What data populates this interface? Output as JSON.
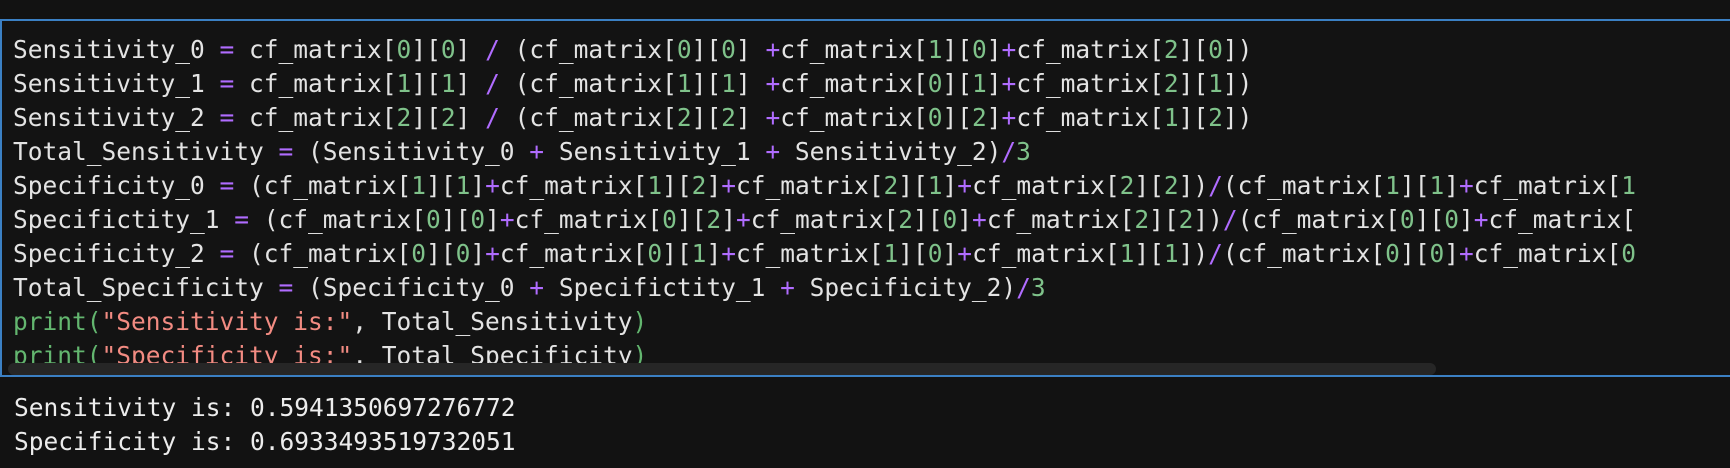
{
  "editor": {
    "lines": [
      [
        [
          "id",
          "Sensitivity_0 "
        ],
        [
          "op",
          "="
        ],
        [
          "id",
          " cf_matrix["
        ],
        [
          "num",
          "0"
        ],
        [
          "id",
          "]["
        ],
        [
          "num",
          "0"
        ],
        [
          "id",
          "] "
        ],
        [
          "op",
          "/"
        ],
        [
          "id",
          " (cf_matrix["
        ],
        [
          "num",
          "0"
        ],
        [
          "id",
          "]["
        ],
        [
          "num",
          "0"
        ],
        [
          "id",
          "] "
        ],
        [
          "op",
          "+"
        ],
        [
          "id",
          "cf_matrix["
        ],
        [
          "num",
          "1"
        ],
        [
          "id",
          "]["
        ],
        [
          "num",
          "0"
        ],
        [
          "id",
          "]"
        ],
        [
          "op",
          "+"
        ],
        [
          "id",
          "cf_matrix["
        ],
        [
          "num",
          "2"
        ],
        [
          "id",
          "]["
        ],
        [
          "num",
          "0"
        ],
        [
          "id",
          "])"
        ]
      ],
      [
        [
          "id",
          "Sensitivity_1 "
        ],
        [
          "op",
          "="
        ],
        [
          "id",
          " cf_matrix["
        ],
        [
          "num",
          "1"
        ],
        [
          "id",
          "]["
        ],
        [
          "num",
          "1"
        ],
        [
          "id",
          "] "
        ],
        [
          "op",
          "/"
        ],
        [
          "id",
          " (cf_matrix["
        ],
        [
          "num",
          "1"
        ],
        [
          "id",
          "]["
        ],
        [
          "num",
          "1"
        ],
        [
          "id",
          "] "
        ],
        [
          "op",
          "+"
        ],
        [
          "id",
          "cf_matrix["
        ],
        [
          "num",
          "0"
        ],
        [
          "id",
          "]["
        ],
        [
          "num",
          "1"
        ],
        [
          "id",
          "]"
        ],
        [
          "op",
          "+"
        ],
        [
          "id",
          "cf_matrix["
        ],
        [
          "num",
          "2"
        ],
        [
          "id",
          "]["
        ],
        [
          "num",
          "1"
        ],
        [
          "id",
          "])"
        ]
      ],
      [
        [
          "id",
          "Sensitivity_2 "
        ],
        [
          "op",
          "="
        ],
        [
          "id",
          " cf_matrix["
        ],
        [
          "num",
          "2"
        ],
        [
          "id",
          "]["
        ],
        [
          "num",
          "2"
        ],
        [
          "id",
          "] "
        ],
        [
          "op",
          "/"
        ],
        [
          "id",
          " (cf_matrix["
        ],
        [
          "num",
          "2"
        ],
        [
          "id",
          "]["
        ],
        [
          "num",
          "2"
        ],
        [
          "id",
          "] "
        ],
        [
          "op",
          "+"
        ],
        [
          "id",
          "cf_matrix["
        ],
        [
          "num",
          "0"
        ],
        [
          "id",
          "]["
        ],
        [
          "num",
          "2"
        ],
        [
          "id",
          "]"
        ],
        [
          "op",
          "+"
        ],
        [
          "id",
          "cf_matrix["
        ],
        [
          "num",
          "1"
        ],
        [
          "id",
          "]["
        ],
        [
          "num",
          "2"
        ],
        [
          "id",
          "])"
        ]
      ],
      [
        [
          "id",
          "Total_Sensitivity "
        ],
        [
          "op",
          "="
        ],
        [
          "id",
          " (Sensitivity_0 "
        ],
        [
          "op",
          "+"
        ],
        [
          "id",
          " Sensitivity_1 "
        ],
        [
          "op",
          "+"
        ],
        [
          "id",
          " Sensitivity_2)"
        ],
        [
          "op",
          "/"
        ],
        [
          "num",
          "3"
        ]
      ],
      [
        [
          "id",
          "Specificity_0 "
        ],
        [
          "op",
          "="
        ],
        [
          "id",
          " (cf_matrix["
        ],
        [
          "num",
          "1"
        ],
        [
          "id",
          "]["
        ],
        [
          "num",
          "1"
        ],
        [
          "id",
          "]"
        ],
        [
          "op",
          "+"
        ],
        [
          "id",
          "cf_matrix["
        ],
        [
          "num",
          "1"
        ],
        [
          "id",
          "]["
        ],
        [
          "num",
          "2"
        ],
        [
          "id",
          "]"
        ],
        [
          "op",
          "+"
        ],
        [
          "id",
          "cf_matrix["
        ],
        [
          "num",
          "2"
        ],
        [
          "id",
          "]["
        ],
        [
          "num",
          "1"
        ],
        [
          "id",
          "]"
        ],
        [
          "op",
          "+"
        ],
        [
          "id",
          "cf_matrix["
        ],
        [
          "num",
          "2"
        ],
        [
          "id",
          "]["
        ],
        [
          "num",
          "2"
        ],
        [
          "id",
          "])"
        ],
        [
          "op",
          "/"
        ],
        [
          "id",
          "(cf_matrix["
        ],
        [
          "num",
          "1"
        ],
        [
          "id",
          "]["
        ],
        [
          "num",
          "1"
        ],
        [
          "id",
          "]"
        ],
        [
          "op",
          "+"
        ],
        [
          "id",
          "cf_matrix["
        ],
        [
          "num",
          "1"
        ]
      ],
      [
        [
          "id",
          "Specifictity_1 "
        ],
        [
          "op",
          "="
        ],
        [
          "id",
          " (cf_matrix["
        ],
        [
          "num",
          "0"
        ],
        [
          "id",
          "]["
        ],
        [
          "num",
          "0"
        ],
        [
          "id",
          "]"
        ],
        [
          "op",
          "+"
        ],
        [
          "id",
          "cf_matrix["
        ],
        [
          "num",
          "0"
        ],
        [
          "id",
          "]["
        ],
        [
          "num",
          "2"
        ],
        [
          "id",
          "]"
        ],
        [
          "op",
          "+"
        ],
        [
          "id",
          "cf_matrix["
        ],
        [
          "num",
          "2"
        ],
        [
          "id",
          "]["
        ],
        [
          "num",
          "0"
        ],
        [
          "id",
          "]"
        ],
        [
          "op",
          "+"
        ],
        [
          "id",
          "cf_matrix["
        ],
        [
          "num",
          "2"
        ],
        [
          "id",
          "]["
        ],
        [
          "num",
          "2"
        ],
        [
          "id",
          "])"
        ],
        [
          "op",
          "/"
        ],
        [
          "id",
          "(cf_matrix["
        ],
        [
          "num",
          "0"
        ],
        [
          "id",
          "]["
        ],
        [
          "num",
          "0"
        ],
        [
          "id",
          "]"
        ],
        [
          "op",
          "+"
        ],
        [
          "id",
          "cf_matrix["
        ]
      ],
      [
        [
          "id",
          "Specificity_2 "
        ],
        [
          "op",
          "="
        ],
        [
          "id",
          " (cf_matrix["
        ],
        [
          "num",
          "0"
        ],
        [
          "id",
          "]["
        ],
        [
          "num",
          "0"
        ],
        [
          "id",
          "]"
        ],
        [
          "op",
          "+"
        ],
        [
          "id",
          "cf_matrix["
        ],
        [
          "num",
          "0"
        ],
        [
          "id",
          "]["
        ],
        [
          "num",
          "1"
        ],
        [
          "id",
          "]"
        ],
        [
          "op",
          "+"
        ],
        [
          "id",
          "cf_matrix["
        ],
        [
          "num",
          "1"
        ],
        [
          "id",
          "]["
        ],
        [
          "num",
          "0"
        ],
        [
          "id",
          "]"
        ],
        [
          "op",
          "+"
        ],
        [
          "id",
          "cf_matrix["
        ],
        [
          "num",
          "1"
        ],
        [
          "id",
          "]["
        ],
        [
          "num",
          "1"
        ],
        [
          "id",
          "])"
        ],
        [
          "op",
          "/"
        ],
        [
          "id",
          "(cf_matrix["
        ],
        [
          "num",
          "0"
        ],
        [
          "id",
          "]["
        ],
        [
          "num",
          "0"
        ],
        [
          "id",
          "]"
        ],
        [
          "op",
          "+"
        ],
        [
          "id",
          "cf_matrix["
        ],
        [
          "num",
          "0"
        ]
      ],
      [
        [
          "id",
          "Total_Specificity "
        ],
        [
          "op",
          "="
        ],
        [
          "id",
          " (Specificity_0 "
        ],
        [
          "op",
          "+"
        ],
        [
          "id",
          " Specifictity_1 "
        ],
        [
          "op",
          "+"
        ],
        [
          "id",
          " Specificity_2)"
        ],
        [
          "op",
          "/"
        ],
        [
          "num",
          "3"
        ]
      ],
      [
        [
          "fn",
          "print("
        ],
        [
          "str",
          "\"Sensitivity is:\""
        ],
        [
          "id",
          ", Total_Sensitivity"
        ],
        [
          "fn",
          ")"
        ]
      ],
      [
        [
          "fn",
          "print("
        ],
        [
          "str",
          "\"Specificity is:\""
        ],
        [
          "id",
          ", Total_Specificity"
        ],
        [
          "fn",
          ")"
        ]
      ]
    ]
  },
  "output": {
    "lines": [
      "Sensitivity is: 0.5941350697276772",
      "Specificity is: 0.6933493519732051"
    ]
  },
  "colors": {
    "background": "#121212",
    "cell_border": "#3b80c4",
    "number": "#7fc28a",
    "operator": "#b06cff",
    "string": "#f28b82",
    "function": "#63b66f",
    "text": "#e3e3e3"
  }
}
